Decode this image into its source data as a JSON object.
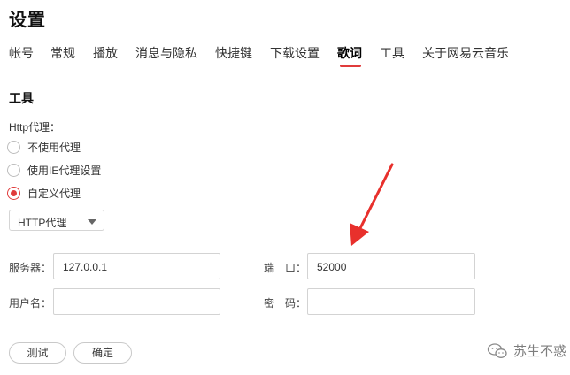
{
  "page": {
    "title": "设置"
  },
  "tabs": [
    {
      "label": "帐号"
    },
    {
      "label": "常规"
    },
    {
      "label": "播放"
    },
    {
      "label": "消息与隐私"
    },
    {
      "label": "快捷键"
    },
    {
      "label": "下载设置"
    },
    {
      "label": "歌词",
      "active": true
    },
    {
      "label": "工具"
    },
    {
      "label": "关于网易云音乐"
    }
  ],
  "section": {
    "title": "工具"
  },
  "proxy": {
    "label": "Http代理：",
    "options": [
      {
        "label": "不使用代理",
        "checked": false
      },
      {
        "label": "使用IE代理设置",
        "checked": false
      },
      {
        "label": "自定义代理",
        "checked": true
      }
    ],
    "type_select": {
      "value": "HTTP代理"
    },
    "server": {
      "label": "服务器：",
      "value": "127.0.0.1"
    },
    "port": {
      "label": "端　口：",
      "value": "52000"
    },
    "username": {
      "label": "用户名：",
      "value": ""
    },
    "password": {
      "label": "密　码：",
      "value": ""
    }
  },
  "buttons": {
    "test": "测试",
    "confirm": "确定"
  },
  "watermark": {
    "text": "苏生不惑",
    "icon": "wechat-icon"
  },
  "colors": {
    "accent": "#e03b3b",
    "arrow": "#e8302c"
  }
}
